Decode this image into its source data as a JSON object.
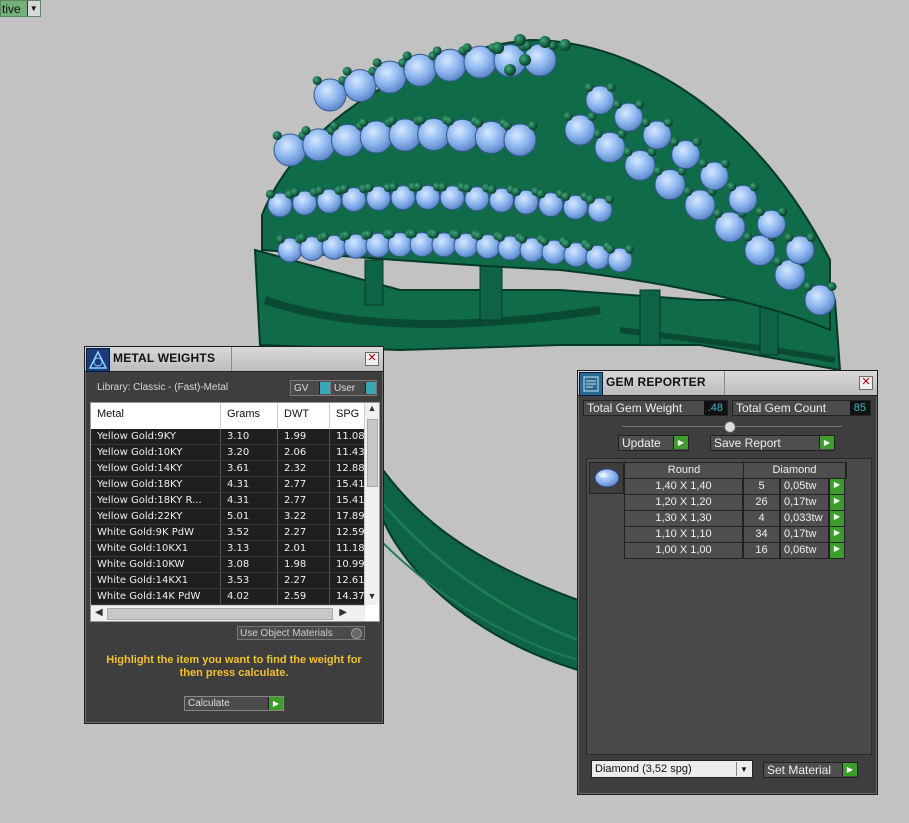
{
  "top_tab": {
    "text": "tive"
  },
  "metal_weights": {
    "title": "METAL WEIGHTS",
    "library": "Library: Classic - (Fast)-Metal",
    "gv_label": "GV",
    "user_label": "User",
    "columns": [
      "Metal",
      "Grams",
      "DWT",
      "SPG"
    ],
    "rows": [
      [
        "Yellow Gold:9KY",
        "3.10",
        "1.99",
        "11.08"
      ],
      [
        "Yellow Gold:10KY",
        "3.20",
        "2.06",
        "11.43"
      ],
      [
        "Yellow Gold:14KY",
        "3.61",
        "2.32",
        "12.88"
      ],
      [
        "Yellow Gold:18KY",
        "4.31",
        "2.77",
        "15.41"
      ],
      [
        "Yellow Gold:18KY R...",
        "4.31",
        "2.77",
        "15.41"
      ],
      [
        "Yellow Gold:22KY",
        "5.01",
        "3.22",
        "17.89"
      ],
      [
        "White Gold:9K PdW",
        "3.52",
        "2.27",
        "12.59"
      ],
      [
        "White Gold:10KX1",
        "3.13",
        "2.01",
        "11.18"
      ],
      [
        "White Gold:10KW",
        "3.08",
        "1.98",
        "10.99"
      ],
      [
        "White Gold:14KX1",
        "3.53",
        "2.27",
        "12.61"
      ],
      [
        "White Gold:14K PdW",
        "4.02",
        "2.59",
        "14.37"
      ]
    ],
    "use_object_materials": "Use Object Materials",
    "hint": "Highlight the item you want to find the weight for then press calculate.",
    "calculate_label": "Calculate"
  },
  "gem_reporter": {
    "title": "GEM REPORTER",
    "total_weight_label": "Total Gem Weight",
    "total_weight_value": ".48",
    "total_count_label": "Total Gem Count",
    "total_count_value": "85",
    "update_label": "Update",
    "save_report_label": "Save Report",
    "shape_header": "Round",
    "material_header": "Diamond",
    "gems": [
      [
        "1,40 X 1,40",
        "5",
        "0,05tw"
      ],
      [
        "1,20 X 1,20",
        "26",
        "0,17tw"
      ],
      [
        "1,30 X 1,30",
        "4",
        "0,033tw"
      ],
      [
        "1,10 X 1,10",
        "34",
        "0,17tw"
      ],
      [
        "1,00 X 1,00",
        "16",
        "0,06tw"
      ]
    ],
    "material_select": "Diamond     (3,52 spg)",
    "set_material_label": "Set Material"
  },
  "colors": {
    "ring_green": "#0f6b48",
    "gem_blue": "#8cb8f0",
    "accent_green": "#3c9c2c",
    "hint_yellow": "#f2c12e"
  }
}
